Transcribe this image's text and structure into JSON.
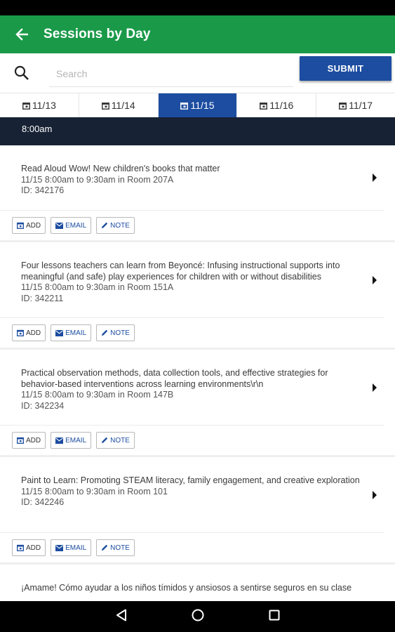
{
  "app_bar": {
    "title": "Sessions by Day"
  },
  "search": {
    "placeholder": "Search",
    "submit_label": "SUBMIT"
  },
  "tabs": [
    {
      "label": "11/13",
      "active": false
    },
    {
      "label": "11/14",
      "active": false
    },
    {
      "label": "11/15",
      "active": true
    },
    {
      "label": "11/16",
      "active": false
    },
    {
      "label": "11/17",
      "active": false
    }
  ],
  "time_header": "8:00am",
  "actions": {
    "add": "ADD",
    "email": "EMAIL",
    "note": "NOTE"
  },
  "sessions": [
    {
      "title": "Read Aloud Wow! New children's books that matter",
      "time": "11/15 8:00am to 9:30am in Room 207A",
      "id": "ID: 342176"
    },
    {
      "title": "Four lessons teachers can learn from Beyoncé: Infusing instructional supports into meaningful (and safe) play experiences for children with or without disabilities",
      "time": "11/15 8:00am to 9:30am in Room 151A",
      "id": "ID: 342211"
    },
    {
      "title": "Practical observation methods, data collection tools, and effective strategies for behavior-based interventions across learning environments\\r\\n",
      "time": "11/15 8:00am to 9:30am in Room 147B",
      "id": "ID: 342234"
    },
    {
      "title": "Paint to Learn: Promoting STEAM literacy, family engagement, and creative exploration",
      "time": "11/15 8:00am to 9:30am in Room 101",
      "id": "ID: 342246"
    },
    {
      "title": "¡Amame! Cómo ayudar a los niños tímidos y ansiosos a sentirse seguros en su clase",
      "time": "",
      "id": ""
    }
  ],
  "colors": {
    "app_bar": "#1a9a49",
    "accent": "#1c4da0",
    "time_header": "#172234"
  }
}
